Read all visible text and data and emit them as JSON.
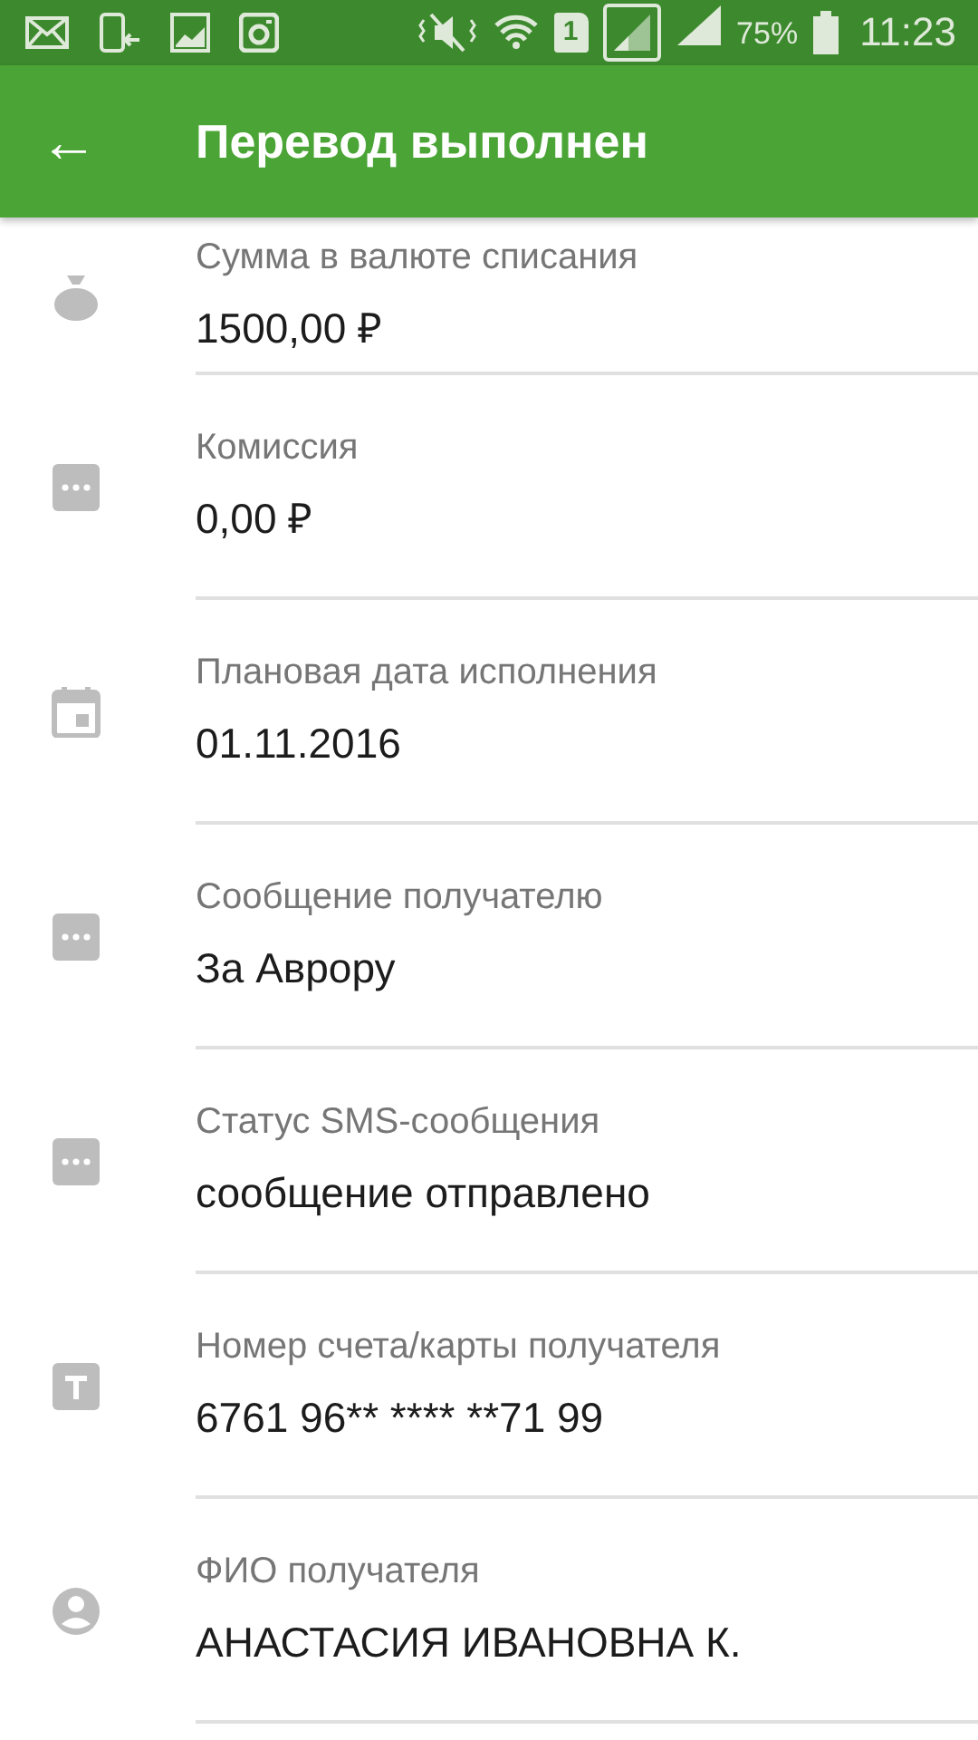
{
  "status_bar": {
    "sim": "1",
    "battery": "75%",
    "time": "11:23"
  },
  "app_bar": {
    "back": "←",
    "title": "Перевод выполнен"
  },
  "details": [
    {
      "kind": "bag",
      "label": "Сумма в валюте списания",
      "value": "1500,00 ₽"
    },
    {
      "kind": "dots",
      "label": "Комиссия",
      "value": "0,00 ₽"
    },
    {
      "kind": "calendar",
      "label": "Плановая дата исполнения",
      "value": "01.11.2016"
    },
    {
      "kind": "dots",
      "label": "Сообщение получателю",
      "value": "За Аврору"
    },
    {
      "kind": "dots",
      "label": "Статус SMS-сообщения",
      "value": "сообщение отправлено"
    },
    {
      "kind": "text",
      "label": "Номер счета/карты получателя",
      "value": "6761 96** **** **71 99"
    },
    {
      "kind": "person",
      "label": "ФИО получателя",
      "value": "АНАСТАСИЯ ИВАНОВНА К."
    }
  ]
}
